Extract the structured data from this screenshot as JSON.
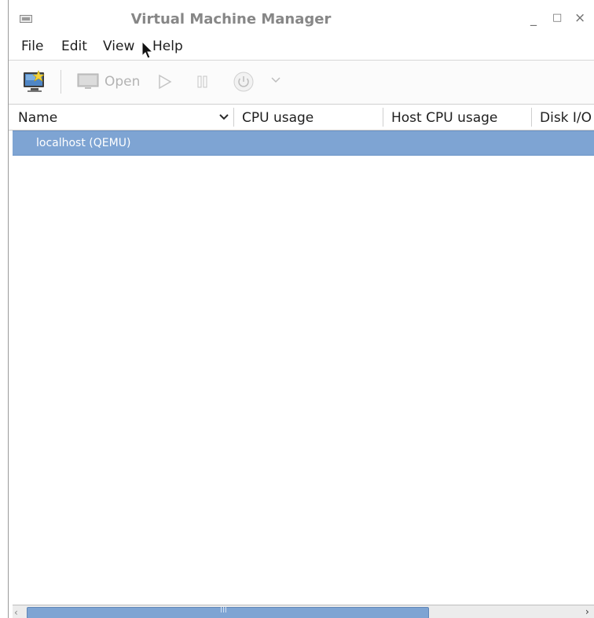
{
  "window": {
    "title": "Virtual Machine Manager",
    "controls": {
      "minimize": "_",
      "maximize": "□",
      "close": "×"
    }
  },
  "menubar": {
    "items": [
      "File",
      "Edit",
      "View",
      "Help"
    ]
  },
  "toolbar": {
    "new_vm_icon": "new-vm-icon",
    "open_label": "Open",
    "run_icon": "play-icon",
    "pause_icon": "pause-icon",
    "power_icon": "power-icon",
    "more_icon": "chevron-down-icon"
  },
  "table": {
    "columns": [
      "Name",
      "CPU usage",
      "Host CPU usage",
      "Disk I/O"
    ],
    "rows": [
      {
        "name": "localhost (QEMU)",
        "selected": true
      }
    ]
  },
  "scrollbar": {
    "left": "‹",
    "right": "›",
    "grip": "III"
  },
  "colors": {
    "selection": "#7ea4d3",
    "title_text": "#878787"
  }
}
